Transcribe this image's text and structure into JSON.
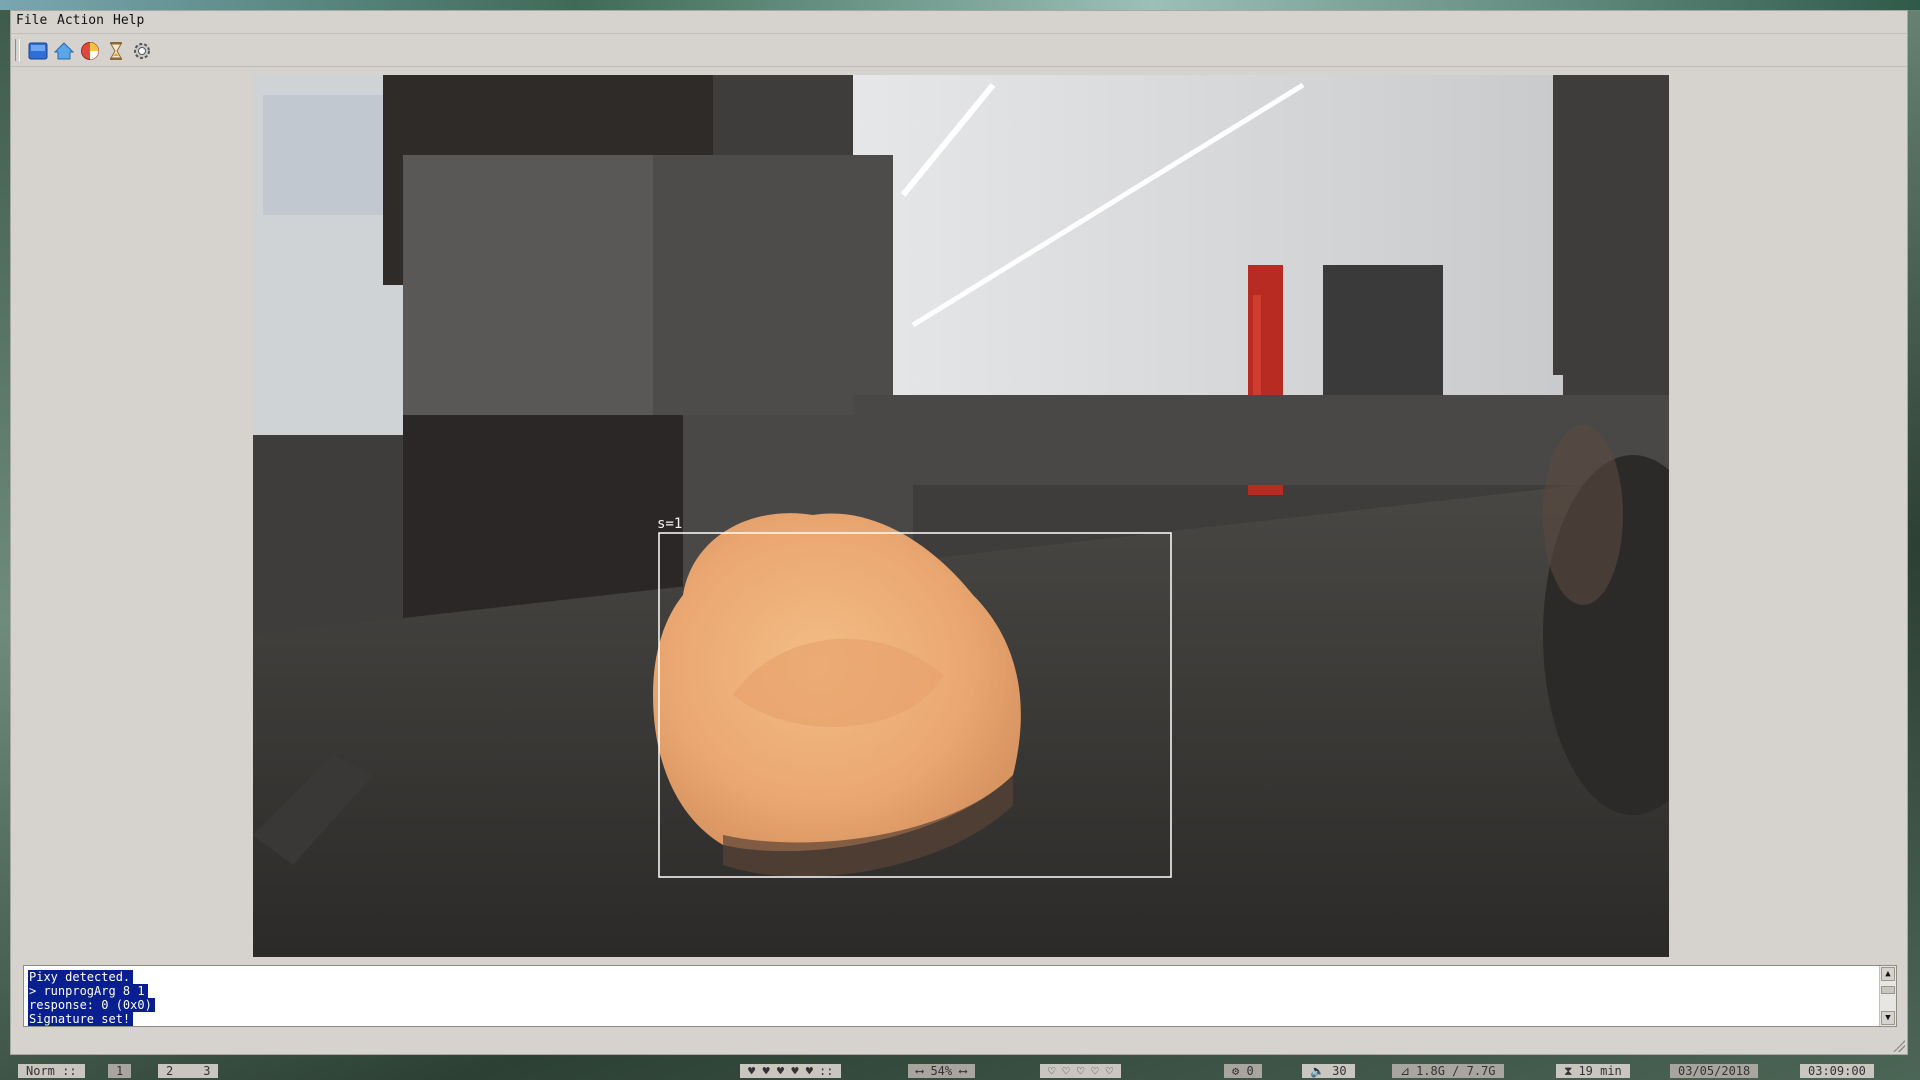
{
  "menu": {
    "file": "File",
    "action": "Action",
    "help": "Help"
  },
  "toolbar": {
    "icons": [
      "monitor-icon",
      "home-icon",
      "color-wheel-icon",
      "hourglass-icon",
      "gear-icon"
    ]
  },
  "camera": {
    "box_label": "s=1"
  },
  "console": {
    "lines": [
      "Pixy detected.",
      "> runprogArg 8 1",
      "response: 0 (0x0)",
      "Signature set!"
    ]
  },
  "statusbar": {
    "mode": "Norm ::",
    "workspaces": [
      "1",
      "2",
      "3"
    ],
    "hearts": "♥ ♥ ♥ ♥ ♥",
    "separator": "::",
    "width_readout": "⟷ 54% ⟷",
    "hearts_empty": "♡ ♡ ♡ ♡ ♡",
    "cpu": "⚙ 0",
    "volume": "🔈 30",
    "memory": "1.8G / 7.7G",
    "battery": "19 min",
    "date": "03/05/2018",
    "time": "03:09:00"
  },
  "colors": {
    "window_bg": "#d6d3ce",
    "console_highlight": "#0a1f8f",
    "object": "#f0b27c"
  }
}
